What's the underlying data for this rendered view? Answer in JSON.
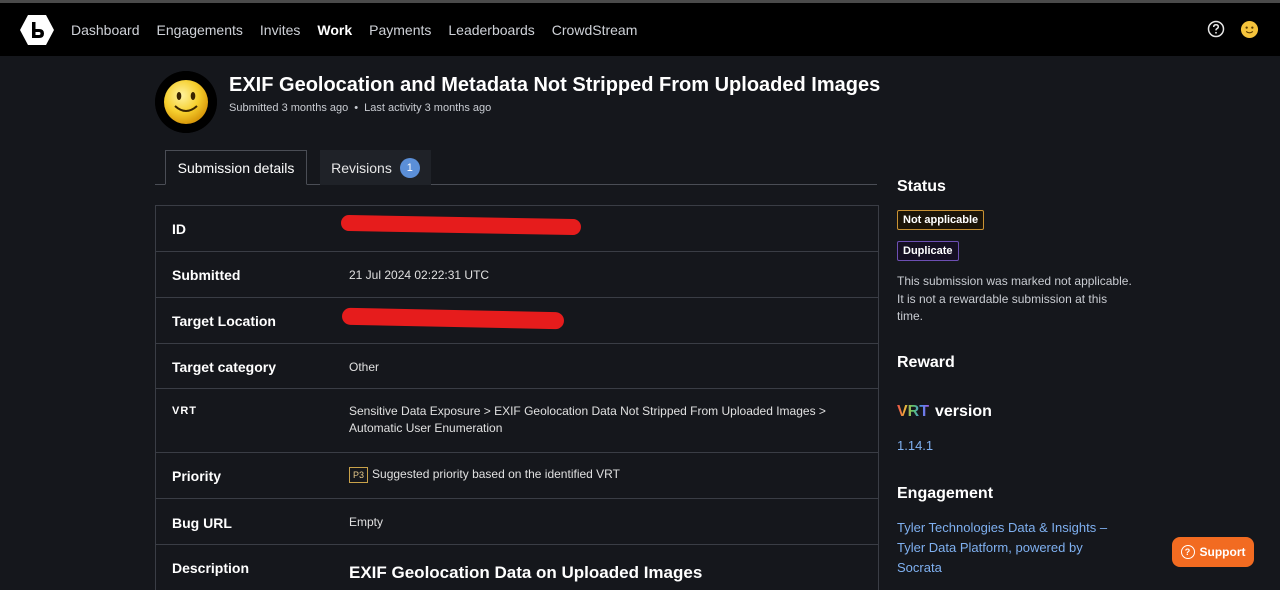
{
  "nav": {
    "items": [
      {
        "label": "Dashboard",
        "active": false
      },
      {
        "label": "Engagements",
        "active": false
      },
      {
        "label": "Invites",
        "active": false
      },
      {
        "label": "Work",
        "active": true
      },
      {
        "label": "Payments",
        "active": false
      },
      {
        "label": "Leaderboards",
        "active": false
      },
      {
        "label": "CrowdStream",
        "active": false
      }
    ],
    "logo_icon": "bugcrowd-logo-icon",
    "help_icon": "help-icon",
    "user_icon": "user-avatar-icon"
  },
  "header": {
    "title": "EXIF Geolocation and Metadata Not Stripped From Uploaded Images",
    "submitted": "Submitted 3 months ago",
    "separator": "•",
    "last_activity": "Last activity 3 months ago"
  },
  "tabs": {
    "details": "Submission details",
    "revisions": "Revisions",
    "revisions_count": "1"
  },
  "details": {
    "id_label": "ID",
    "submitted_label": "Submitted",
    "submitted_value": "21 Jul 2024 02:22:31 UTC",
    "target_location_label": "Target Location",
    "target_category_label": "Target category",
    "target_category_value": "Other",
    "vrt_label": "VRT",
    "vrt_value": "Sensitive Data Exposure > EXIF Geolocation Data Not Stripped From Uploaded Images > Automatic User Enumeration",
    "priority_label": "Priority",
    "priority_badge": "P3",
    "priority_value": "Suggested priority based on the identified VRT",
    "bug_url_label": "Bug URL",
    "bug_url_value": "Empty",
    "description_label": "Description",
    "description_title": "EXIF Geolocation Data on Uploaded Images"
  },
  "sidebar": {
    "status_heading": "Status",
    "status_not_applicable": "Not applicable",
    "status_duplicate": "Duplicate",
    "status_text": "This submission was marked not applicable. It is not a rewardable submission at this time.",
    "reward_heading": "Reward",
    "vrt_logo": "VRT",
    "vrt_version_label": "version",
    "vrt_version": "1.14.1",
    "engagement_heading": "Engagement",
    "engagement_link": "Tyler Technologies Data & Insights – Tyler Data Platform, powered by Socrata"
  },
  "support": {
    "label": "Support"
  },
  "colors": {
    "background": "#15171c",
    "navbar": "#000000",
    "link": "#7fb0f0",
    "support": "#f26b21",
    "redaction": "#e61c1c"
  }
}
